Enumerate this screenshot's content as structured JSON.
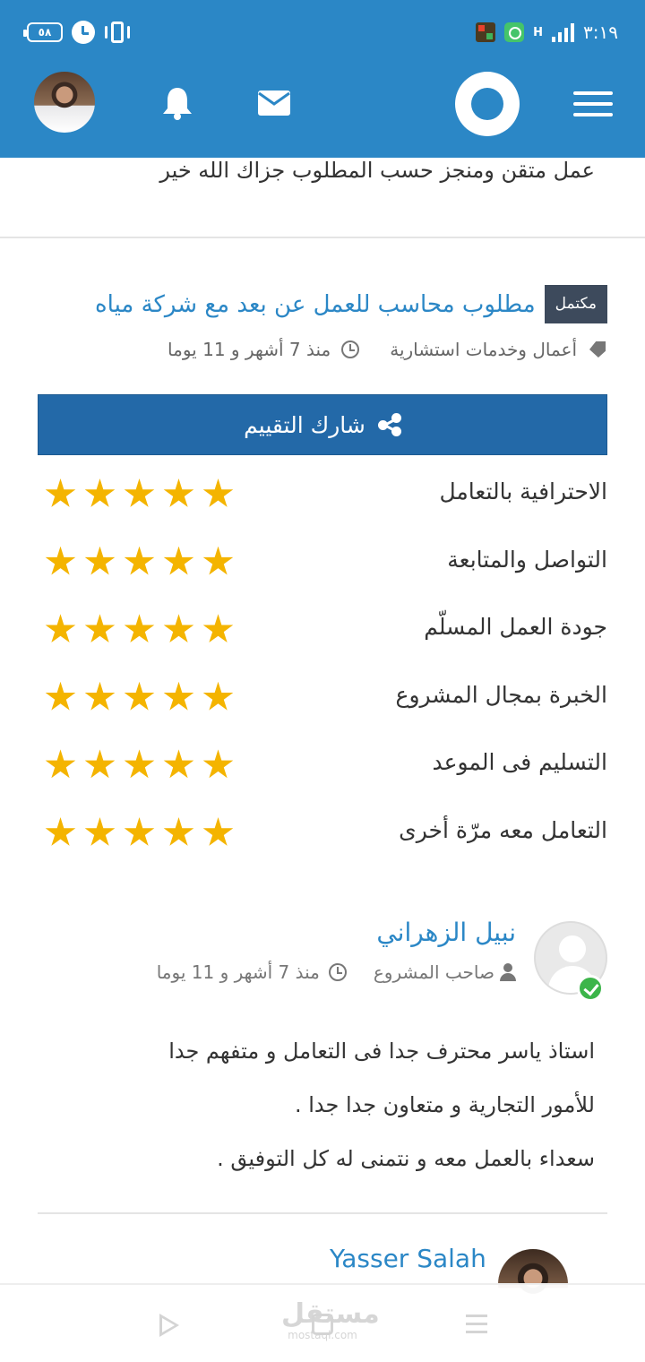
{
  "status_bar": {
    "battery": "٥٨",
    "time": "٣:١٩",
    "network": "H"
  },
  "header": {
    "icons": [
      "menu-icon",
      "mostaql-logo",
      "mail-icon",
      "bell-icon",
      "avatar"
    ],
    "accent_color": "#2b87c6"
  },
  "previous_review": {
    "text": "عمل متقن ومنجز حسب المطلوب جزاك الله خير"
  },
  "project": {
    "status_badge": "مكتمل",
    "title": "مطلوب محاسب للعمل عن بعد مع شركة مياه",
    "category": "أعمال وخدمات استشارية",
    "time": "منذ 7 أشهر و 11 يوما"
  },
  "share_button": {
    "label": "شارك التقييم",
    "color": "#2369a8"
  },
  "ratings": [
    {
      "label": "الاحترافية بالتعامل",
      "stars": 5
    },
    {
      "label": "التواصل والمتابعة",
      "stars": 5
    },
    {
      "label": "جودة العمل المسلّم",
      "stars": 5
    },
    {
      "label": "الخبرة بمجال المشروع",
      "stars": 5
    },
    {
      "label": "التسليم فى الموعد",
      "stars": 5
    },
    {
      "label": "التعامل معه مرّة أخرى",
      "stars": 5
    }
  ],
  "reviewer": {
    "name": "نبيل الزهراني",
    "role": "صاحب المشروع",
    "time": "منذ 7 أشهر و 11 يوما",
    "verified": true
  },
  "review_lines": [
    "استاذ ياسر محترف جدا فى التعامل و متفهم جدا",
    "للأمور التجارية و متعاون جدا جدا .",
    "سعداء بالعمل معه و نتمنى له كل التوفيق ."
  ],
  "reply": {
    "name": "Yasser Salah"
  },
  "watermark": {
    "main": "مستقل",
    "sub": "mostaql.com"
  }
}
